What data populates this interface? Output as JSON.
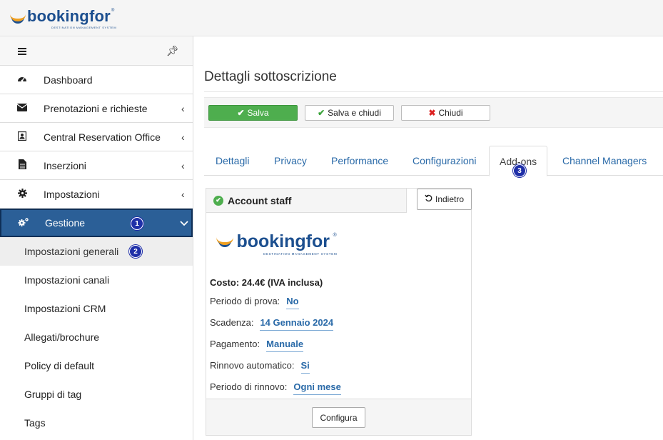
{
  "brand": {
    "name": "bookingfor",
    "registered": "®",
    "tagline": "DESTINATION MANAGEMENT SYSTEM"
  },
  "sidebar": {
    "items": [
      {
        "label": "Dashboard",
        "icon": "tachometer-icon"
      },
      {
        "label": "Prenotazioni e richieste",
        "icon": "envelope-icon",
        "chevron": "‹"
      },
      {
        "label": "Central Reservation Office",
        "icon": "contact-card-icon",
        "chevron": "‹"
      },
      {
        "label": "Inserzioni",
        "icon": "document-icon",
        "chevron": "‹"
      },
      {
        "label": "Impostazioni",
        "icon": "gear-icon",
        "chevron": "‹"
      },
      {
        "label": "Gestione",
        "icon": "gears-icon",
        "chevron": "⌄",
        "badge": "1"
      }
    ],
    "subitems": [
      {
        "label": "Impostazioni generali",
        "badge": "2"
      },
      {
        "label": "Impostazioni canali"
      },
      {
        "label": "Impostazioni CRM"
      },
      {
        "label": "Allegati/brochure"
      },
      {
        "label": "Policy di default"
      },
      {
        "label": "Gruppi di tag"
      },
      {
        "label": "Tags"
      }
    ]
  },
  "main": {
    "title": "Dettagli sottoscrizione",
    "toolbar": {
      "save": "Salva",
      "save_close": "Salva e chiudi",
      "close": "Chiudi"
    },
    "tabs": [
      "Dettagli",
      "Privacy",
      "Performance",
      "Configurazioni",
      "Add-ons",
      "Channel Managers"
    ],
    "active_tab_badge": "3",
    "panel": {
      "title": "Account staff",
      "back": "Indietro",
      "cost": "Costo: 24.4€ (IVA inclusa)",
      "rows": [
        {
          "label": "Periodo di prova:",
          "value": "No"
        },
        {
          "label": "Scadenza:",
          "value": "14 Gennaio 2024"
        },
        {
          "label": "Pagamento:",
          "value": "Manuale"
        },
        {
          "label": "Rinnovo automatico:",
          "value": "Si"
        },
        {
          "label": "Periodo di rinnovo:",
          "value": "Ogni mese"
        }
      ],
      "configure": "Configura"
    }
  },
  "colors": {
    "accent": "#2b5f97",
    "save": "#4eae4e",
    "link": "#2a6aa8",
    "badge": "#1f2fa8"
  }
}
